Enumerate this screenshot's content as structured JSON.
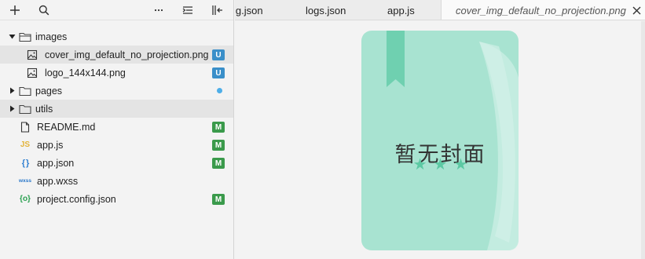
{
  "toolbar": {
    "new_icon": "plus-icon",
    "search_icon": "search-icon",
    "more_icon": "ellipsis-icon",
    "collapse_icon": "collapse-all-icon",
    "panel_icon": "panel-toggle-icon"
  },
  "tree": [
    {
      "label": "images",
      "type": "folder",
      "expanded": true
    },
    {
      "label": "cover_img_default_no_projection.png",
      "type": "image",
      "badge": "U"
    },
    {
      "label": "logo_144x144.png",
      "type": "image",
      "badge": "U"
    },
    {
      "label": "pages",
      "type": "folder",
      "expanded": false
    },
    {
      "label": "utils",
      "type": "folder",
      "expanded": false
    },
    {
      "label": "README.md",
      "type": "file",
      "badge": "M"
    },
    {
      "label": "app.js",
      "type": "js",
      "icon_text": "JS",
      "badge": "M"
    },
    {
      "label": "app.json",
      "type": "json",
      "icon_text": "{ }",
      "badge": "M"
    },
    {
      "label": "app.wxss",
      "type": "wxss",
      "icon_text": "wxss"
    },
    {
      "label": "project.config.json",
      "type": "config",
      "icon_text": "{o}",
      "badge": "M"
    }
  ],
  "tabs": [
    {
      "label": "ig.json"
    },
    {
      "label": "logs.json"
    },
    {
      "label": "app.js"
    },
    {
      "label": "cover_img_default_no_projection.png",
      "active": true
    }
  ],
  "preview": {
    "title": "暂无封面",
    "stars": "★★★"
  },
  "colors": {
    "badge_untracked": "#3a8fc9",
    "badge_modified": "#3a9a4b",
    "dot": "#4eaee8",
    "cover_light": "#a8e3d1",
    "cover_dark": "#6fd0b0"
  }
}
